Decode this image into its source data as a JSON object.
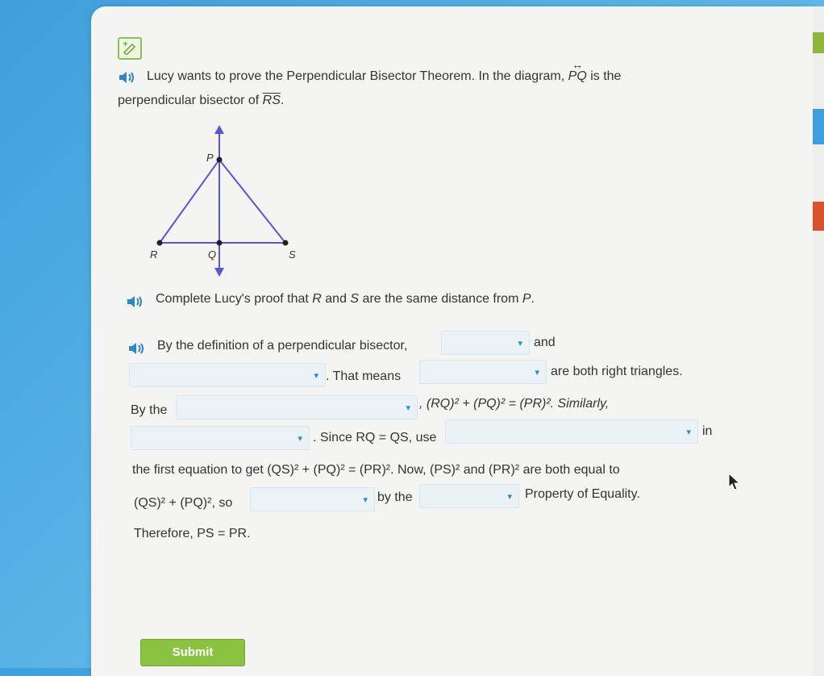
{
  "question": {
    "intro_a": "Lucy wants to prove the Perpendicular Bisector Theorem. In the diagram, ",
    "line_pq": "PQ",
    "intro_b": " is the",
    "intro_c": "perpendicular bisector of ",
    "seg_rs": "RS",
    "intro_d": "."
  },
  "diagram": {
    "label_p": "P",
    "label_q": "Q",
    "label_r": "R",
    "label_s": "S"
  },
  "instruction": {
    "a": "Complete Lucy's proof that ",
    "r": "R",
    "b": " and ",
    "s": "S",
    "c": " are the same distance from ",
    "p": "P",
    "d": "."
  },
  "proof": {
    "l1_a": "By the definition of a perpendicular bisector,",
    "l1_b": "and",
    "l2_a": ". That means",
    "l2_b": "are both right triangles.",
    "l3_a": "By the",
    "l3_b": ", (RQ)² + (PQ)² = (PR)². Similarly,",
    "l4_a": ". Since RQ = QS, use",
    "l4_b": "in",
    "l5": "the first equation to get (QS)² + (PQ)² = (PR)². Now, (PS)² and (PR)² are both equal to",
    "l6_a": "(QS)² + (PQ)², so",
    "l6_b": "by the",
    "l6_c": "Property of Equality.",
    "l7": "Therefore, PS = PR."
  },
  "dropdown_caret": "▾",
  "submit_label": "Submit",
  "colors": {
    "accent_blue": "#2f87c3",
    "triangle": "#5b55d6",
    "submit_green": "#8ac340"
  }
}
